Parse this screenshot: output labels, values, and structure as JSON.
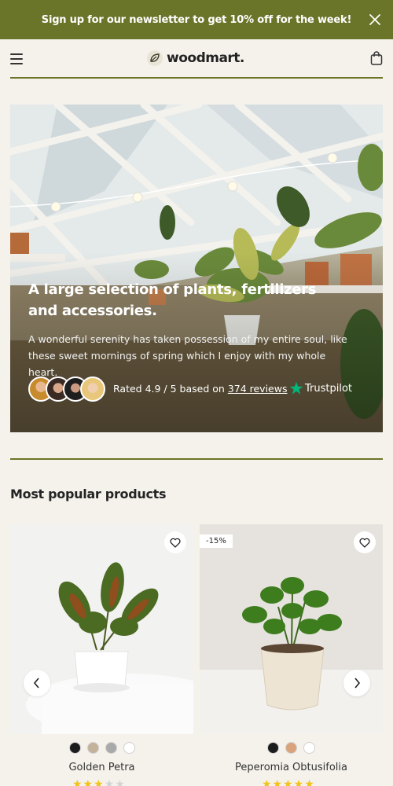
{
  "announcement": {
    "text": "Sign up for our newsletter to get 10% off for the week!"
  },
  "header": {
    "logo": "woodmart."
  },
  "hero": {
    "title": "A large selection of plants, fertilizers and accessories.",
    "text": "A wonderful serenity has taken possession of my entire soul, like these sweet mornings of spring which I enjoy with my whole heart.",
    "rating_prefix": "Rated 4.9 / 5 based on",
    "rating_link": "374 reviews",
    "trustpilot": "Trustpilot"
  },
  "section": {
    "title": "Most popular products"
  },
  "products": [
    {
      "name": "Golden Petra",
      "rating": 3,
      "badge": "",
      "swatches": [
        "#1c1c1c",
        "#c4b29b",
        "#a9a9a9",
        "#ffffff"
      ]
    },
    {
      "name": "Peperomia Obtusifolia",
      "rating": 5,
      "badge": "-15%",
      "swatches": [
        "#1c1c1c",
        "#d9a37c",
        "#ffffff"
      ]
    }
  ],
  "colors": {
    "accent": "#6b7529",
    "star": "#f0c419",
    "trustpilot": "#00b67a"
  }
}
